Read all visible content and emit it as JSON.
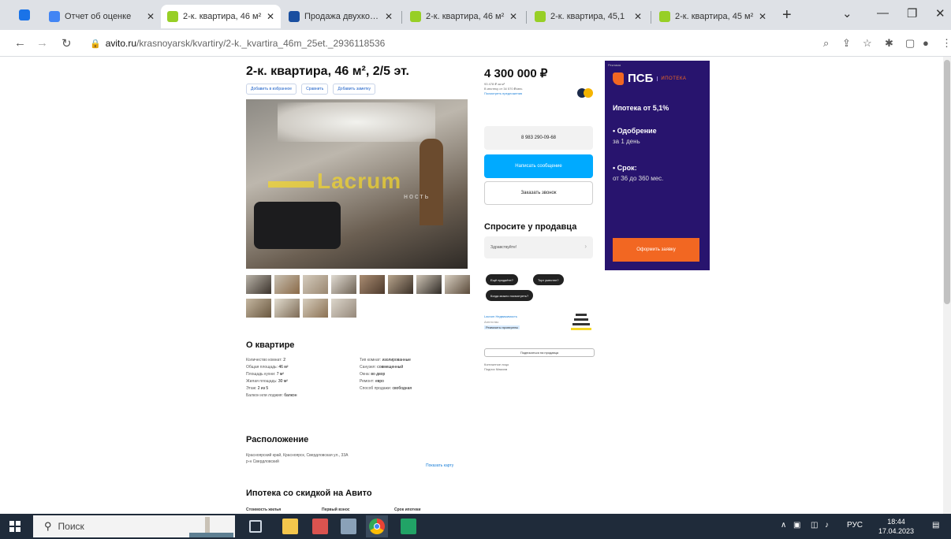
{
  "browser": {
    "tabs": [
      {
        "title": "Отчет об оценке",
        "active": false
      },
      {
        "title": "2-к. квартира, 46 м²",
        "active": true
      },
      {
        "title": "Продажа двухкомн",
        "active": false
      },
      {
        "title": "2-к. квартира, 46 м²",
        "active": false
      },
      {
        "title": "2-к. квартира, 45,1",
        "active": false
      },
      {
        "title": "2-к. квартира, 45 м²",
        "active": false
      }
    ],
    "address": {
      "host": "avito.ru",
      "path": "/krasnoyarsk/kvartiry/2-k._kvartira_46m_25et._2936118536"
    }
  },
  "listing": {
    "title": "2-к. квартира, 46 м², 2/5 эт.",
    "actions": [
      "Добавить в избранное",
      "Сравнить",
      "Добавить заметку"
    ],
    "watermark": "Lacrum",
    "watermark_sub": "ность",
    "about_title": "О квартире",
    "params_left": [
      {
        "label": "Количество комнат:",
        "value": "2"
      },
      {
        "label": "Общая площадь:",
        "value": "46 м²"
      },
      {
        "label": "Площадь кухни:",
        "value": "7 м²"
      },
      {
        "label": "Жилая площадь:",
        "value": "30 м²"
      },
      {
        "label": "Этаж:",
        "value": "2 из 5"
      },
      {
        "label": "Балкон или лоджия:",
        "value": "балкон"
      }
    ],
    "params_right": [
      {
        "label": "Тип комнат:",
        "value": "изолированные"
      },
      {
        "label": "Санузел:",
        "value": "совмещенный"
      },
      {
        "label": "Окна:",
        "value": "во двор"
      },
      {
        "label": "Ремонт:",
        "value": "евро"
      },
      {
        "label": "Способ продажи:",
        "value": "свободная"
      }
    ],
    "location_title": "Расположение",
    "address_line1": "Красноярский край, Красноярск, Свердловская ул., 33А",
    "address_line2": "р-н Свердловский",
    "map_link": "Показать карту",
    "mortgage_title": "Ипотека со скидкой на Авито",
    "mortgage_labels": [
      "Стоимость жилья",
      "Первый взнос",
      "Срок ипотеки"
    ]
  },
  "sidebar": {
    "price": "4 300 000 ₽",
    "price_per_m": "93 478 ₽ за м²",
    "mortgage_hint": "В ипотеку от 34 570 ₽/мес.",
    "mortgage_link": "Посмотреть предложения",
    "phone": "8 983 290-09-68",
    "write_btn": "Написать сообщение",
    "call_btn": "Заказать звонок",
    "ask_title": "Спросите у продавца",
    "ask_placeholder": "Здравствуйте!",
    "chips": [
      "Ещё продаёте?",
      "Торг уместен?",
      "Когда можно посмотреть?"
    ],
    "seller_name": "Lacrum Недвижимость",
    "seller_type": "Агентство",
    "seller_check": "Реквизиты проверены",
    "subscribe_btn": "Подписаться на продавца",
    "contact_label": "Контактное лицо",
    "contact_name": "Поднос Максим"
  },
  "ad": {
    "corner": "Реклама",
    "brand": "ПСБ",
    "brand_sub": "ИПОТЕКА",
    "headline": "Ипотека от 5,1%",
    "b1": "• Одобрение",
    "b1_sub": "за 1 день",
    "b2": "• Срок:",
    "b2_sub": "от 36 до 360 мес.",
    "cta": "Оформить заявку"
  },
  "taskbar": {
    "search_placeholder": "Поиск",
    "lang": "РУС",
    "time": "18:44",
    "date": "17.04.2023"
  },
  "colors": {
    "accent": "#00aaff",
    "ad_bg": "#28146e",
    "ad_orange": "#f26722",
    "watermark": "#f5d728"
  }
}
